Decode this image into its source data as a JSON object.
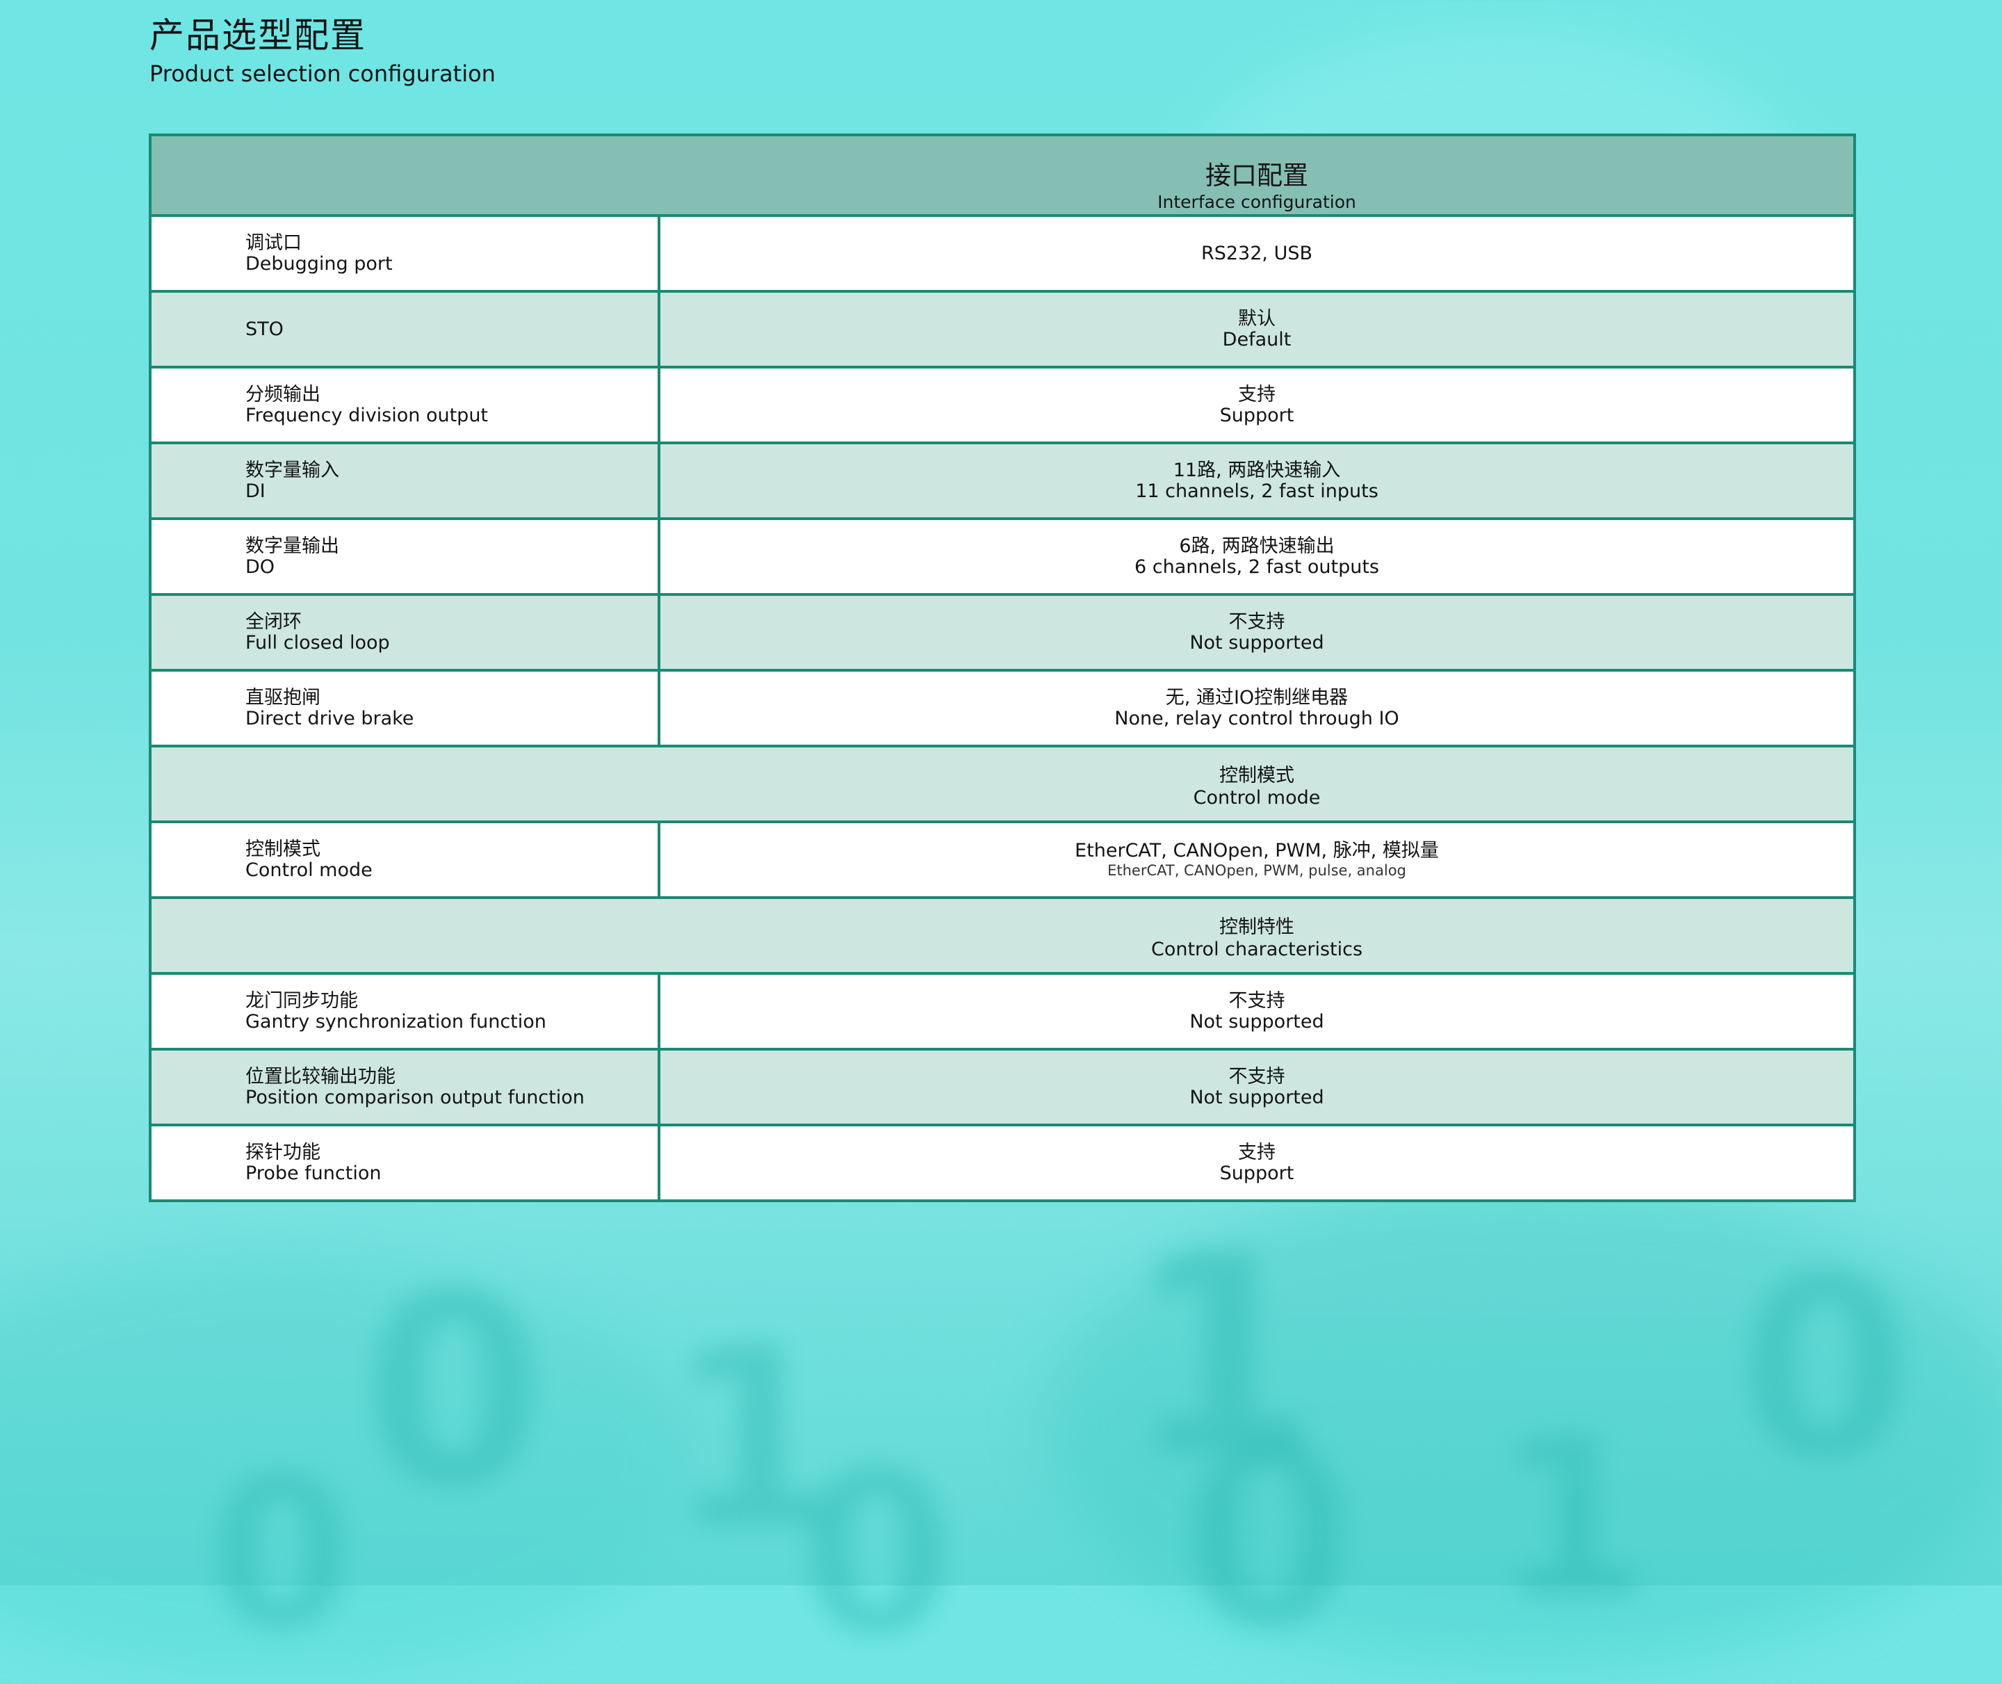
{
  "header": {
    "title_cn": "产品选型配置",
    "title_en": "Product selection configuration"
  },
  "table": {
    "header": {
      "cn": "接口配置",
      "en": "Interface configuration"
    },
    "rows": [
      {
        "type": "row",
        "label_cn": "调试口",
        "label_en": "Debugging port",
        "value_cn": "",
        "value_en": "RS232, USB"
      },
      {
        "type": "row",
        "label_cn": "",
        "label_en": "STO",
        "value_cn": "默认",
        "value_en": "Default"
      },
      {
        "type": "row",
        "label_cn": "分频输出",
        "label_en": "Frequency division output",
        "value_cn": "支持",
        "value_en": "Support"
      },
      {
        "type": "row",
        "label_cn": "数字量输入",
        "label_en": "DI",
        "value_cn": "11路, 两路快速输入",
        "value_en": "11 channels, 2 fast inputs"
      },
      {
        "type": "row",
        "label_cn": "数字量输出",
        "label_en": "DO",
        "value_cn": "6路, 两路快速输出",
        "value_en": "6 channels, 2 fast outputs"
      },
      {
        "type": "row",
        "label_cn": "全闭环",
        "label_en": "Full closed loop",
        "value_cn": "不支持",
        "value_en": "Not supported"
      },
      {
        "type": "row",
        "label_cn": "直驱抱闸",
        "label_en": "Direct drive brake",
        "value_cn": "无, 通过IO控制继电器",
        "value_en": "None, relay control through IO"
      },
      {
        "type": "section",
        "cn": "控制模式",
        "en": "Control mode"
      },
      {
        "type": "row",
        "label_cn": "控制模式",
        "label_en": "Control mode",
        "value_cn": "EtherCAT, CANOpen, PWM, 脉冲, 模拟量",
        "value_en": "EtherCAT, CANOpen, PWM, pulse, analog"
      },
      {
        "type": "section",
        "cn": "控制特性",
        "en": "Control characteristics"
      },
      {
        "type": "row",
        "label_cn": "龙门同步功能",
        "label_en": "Gantry synchronization function",
        "value_cn": "不支持",
        "value_en": "Not supported"
      },
      {
        "type": "row",
        "label_cn": "位置比较输出功能",
        "label_en": "Position comparison output function",
        "value_cn": "不支持",
        "value_en": "Not supported"
      },
      {
        "type": "row",
        "label_cn": "探针功能",
        "label_en": "Probe function",
        "value_cn": "支持",
        "value_en": "Support"
      }
    ]
  }
}
